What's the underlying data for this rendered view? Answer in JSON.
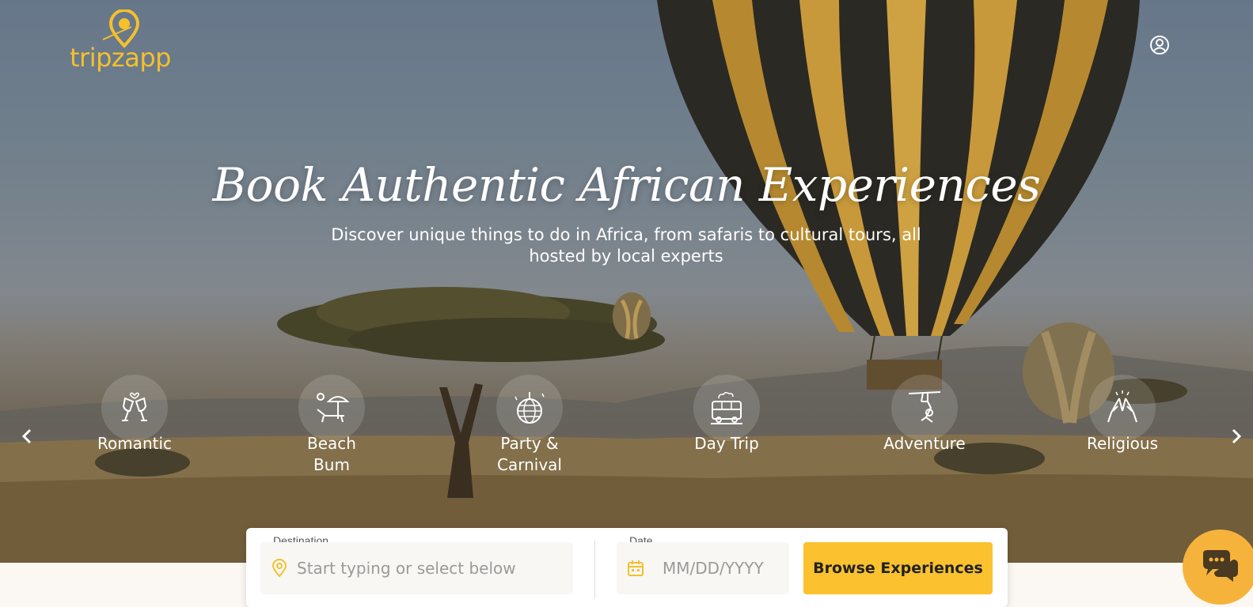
{
  "brand": {
    "name": "tripzapp",
    "color": "#f5c02c"
  },
  "header": {
    "user_icon": "user-circle-icon"
  },
  "hero": {
    "title": "Book Authentic African Experiences",
    "subtitle": "Discover unique things to do in Africa, from safaris to cultural tours, all hosted by local experts"
  },
  "categories": [
    {
      "label": "Romantic",
      "icon": "champagne-glasses-icon"
    },
    {
      "label": "Beach Bum",
      "icon": "beach-lounger-icon"
    },
    {
      "label": "Party & Carnival",
      "icon": "disco-ball-icon"
    },
    {
      "label": "Day Trip",
      "icon": "bus-icon"
    },
    {
      "label": "Adventure",
      "icon": "zipline-icon"
    },
    {
      "label": "Religious",
      "icon": "praying-hands-icon"
    }
  ],
  "search": {
    "destination_label": "Destination",
    "destination_placeholder": "Start typing or select below",
    "date_label": "Date",
    "date_placeholder": "MM/DD/YYYY",
    "browse_label": "Browse Experiences"
  },
  "colors": {
    "accent": "#fbc12e",
    "chat": "#f6b33c"
  }
}
